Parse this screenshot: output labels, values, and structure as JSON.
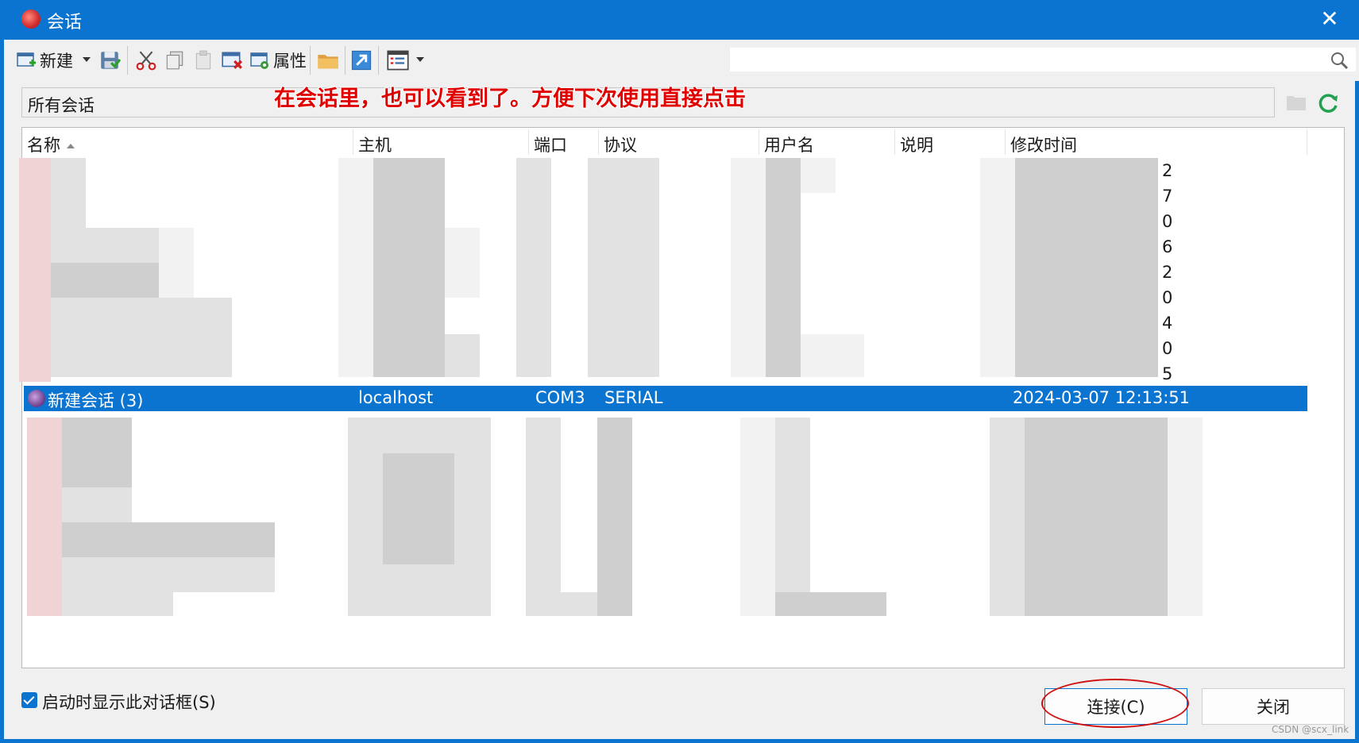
{
  "window": {
    "title": "会话",
    "close_glyph": "✕"
  },
  "toolbar": {
    "new_label": "新建",
    "properties_label": "属性",
    "search": {
      "placeholder": "",
      "value": ""
    },
    "icons": [
      "new-session-icon",
      "dropdown-arrow-icon",
      "save-icon",
      "cut-icon",
      "copy-icon",
      "paste-icon",
      "delete-icon",
      "properties-icon",
      "folder-icon",
      "shortcut-icon",
      "view-icon",
      "dropdown-arrow-icon",
      "search-icon"
    ]
  },
  "filter": {
    "label": "所有会话"
  },
  "annotation": {
    "text": "在会话里，也可以看到了。方便下次使用直接点击"
  },
  "columns": [
    "名称",
    "主机",
    "端口",
    "协议",
    "用户名",
    "说明",
    "修改时间"
  ],
  "visible_digits": [
    "2",
    "7",
    "0",
    "6",
    "2",
    "0",
    "4",
    "0",
    "5"
  ],
  "selected_row": {
    "name": "新建会话 (3)",
    "host": "localhost",
    "port": "COM3",
    "protocol": "SERIAL",
    "user": "",
    "description": "",
    "modified": "2024-03-07 12:13:51"
  },
  "footer": {
    "checkbox_label": "启动时显示此对话框(S)",
    "checkbox_checked": true,
    "connect_label": "连接(C)",
    "close_label": "关闭"
  },
  "watermark": "CSDN @scx_link",
  "colors": {
    "accent": "#0a74d0",
    "annotation": "#e00000"
  }
}
